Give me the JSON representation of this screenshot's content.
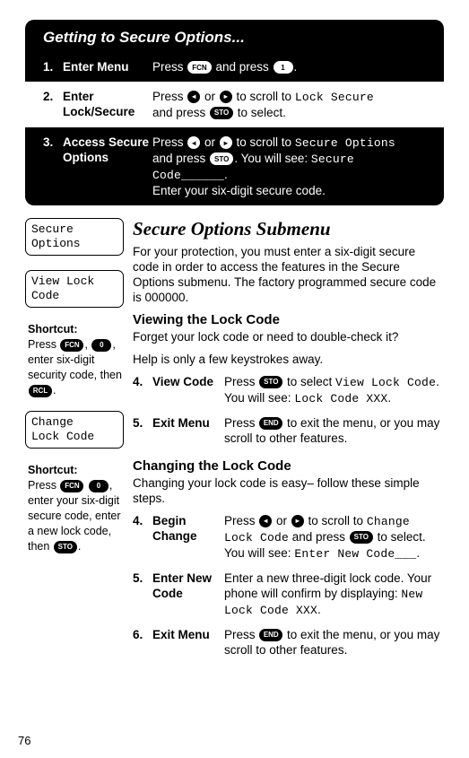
{
  "pageNumber": "76",
  "panel": {
    "title": "Getting to Secure Options...",
    "rows": [
      {
        "num": "1.",
        "label": "Enter Menu",
        "segments": [
          {
            "t": "Press "
          },
          {
            "key": "FCN"
          },
          {
            "t": " and press "
          },
          {
            "key": "1",
            "num": true
          },
          {
            "t": "."
          }
        ]
      },
      {
        "num": "2.",
        "label": "Enter Lock/Secure",
        "segments": [
          {
            "t": "Press "
          },
          {
            "key": "◂",
            "sm": true
          },
          {
            "t": " or "
          },
          {
            "key": "▸",
            "sm": true
          },
          {
            "t": " to scroll to "
          },
          {
            "lcd": "Lock Secure"
          },
          {
            "br": true
          },
          {
            "t": "and press "
          },
          {
            "key": "STO"
          },
          {
            "t": " to select."
          }
        ]
      },
      {
        "num": "3.",
        "label": "Access Secure Options",
        "segments": [
          {
            "t": "Press "
          },
          {
            "key": "◂",
            "sm": true
          },
          {
            "t": " or "
          },
          {
            "key": "▸",
            "sm": true
          },
          {
            "t": " to scroll to "
          },
          {
            "lcd": "Secure Options"
          },
          {
            "br": true
          },
          {
            "t": "and press "
          },
          {
            "key": "STO"
          },
          {
            "t": ". You will see: "
          },
          {
            "lcd": "Secure Code______"
          },
          {
            "t": "."
          },
          {
            "br": true
          },
          {
            "t": "Enter your six-digit secure code."
          }
        ]
      }
    ]
  },
  "sidebar": {
    "lcd1": "Secure\nOptions",
    "lcd2": "View Lock\nCode",
    "shortcut1": {
      "title": "Shortcut:",
      "segments": [
        {
          "t": "Press "
        },
        {
          "key": "FCN"
        },
        {
          "t": ", "
        },
        {
          "key": "0",
          "num": true
        },
        {
          "t": ", enter six-digit security code, then "
        },
        {
          "key": "RCL"
        },
        {
          "t": "."
        }
      ]
    },
    "lcd3": "Change\nLock Code",
    "shortcut2": {
      "title": "Shortcut:",
      "segments": [
        {
          "t": "Press "
        },
        {
          "key": "FCN"
        },
        {
          "t": " "
        },
        {
          "key": "0",
          "num": true
        },
        {
          "t": ", enter your six-digit secure code, enter a new lock code, then "
        },
        {
          "key": "STO"
        },
        {
          "t": "."
        }
      ]
    }
  },
  "main": {
    "h1": "Secure Options Submenu",
    "intro": "For your protection, you must enter a six-digit secure code in order to access the features in the Secure Options submenu. The factory programmed secure code is 000000.",
    "h2a": "Viewing the Lock Code",
    "pa1": "Forget your lock code or need to double-check it?",
    "pa2": "Help is only a few keystrokes away.",
    "stepsA": [
      {
        "num": "4.",
        "label": "View Code",
        "segments": [
          {
            "t": "Press "
          },
          {
            "key": "STO"
          },
          {
            "t": " to select "
          },
          {
            "lcd": "View Lock Code"
          },
          {
            "t": "."
          },
          {
            "br": true
          },
          {
            "t": "You will see: "
          },
          {
            "lcd": "Lock Code XXX"
          },
          {
            "t": "."
          }
        ]
      },
      {
        "num": "5.",
        "label": "Exit Menu",
        "segments": [
          {
            "t": "Press "
          },
          {
            "key": "END"
          },
          {
            "t": " to exit the menu, or you may scroll to other features."
          }
        ]
      }
    ],
    "h2b": "Changing the Lock Code",
    "pb1": "Changing your lock code is easy– follow these simple steps.",
    "stepsB": [
      {
        "num": "4.",
        "label": "Begin Change",
        "segments": [
          {
            "t": "Press "
          },
          {
            "key": "◂",
            "sm": true
          },
          {
            "t": " or "
          },
          {
            "key": "▸",
            "sm": true
          },
          {
            "t": " to scroll to "
          },
          {
            "lcd": "Change Lock Code"
          },
          {
            "t": " and press "
          },
          {
            "key": "STO"
          },
          {
            "t": " to select."
          },
          {
            "br": true
          },
          {
            "t": "You will see:  "
          },
          {
            "lcd": "Enter New Code___"
          },
          {
            "t": "."
          }
        ]
      },
      {
        "num": "5.",
        "label": "Enter New Code",
        "segments": [
          {
            "t": "Enter a new three-digit lock code. Your phone will confirm by displaying: "
          },
          {
            "lcd": "New Lock Code XXX"
          },
          {
            "t": "."
          }
        ]
      },
      {
        "num": "6.",
        "label": "Exit Menu",
        "segments": [
          {
            "t": "Press "
          },
          {
            "key": "END"
          },
          {
            "t": " to exit the menu, or you may scroll to other features."
          }
        ]
      }
    ]
  }
}
